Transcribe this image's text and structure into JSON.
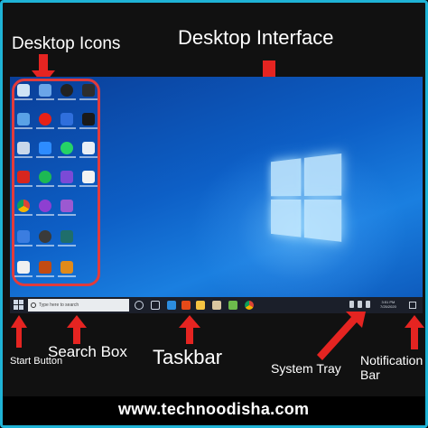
{
  "annotations": {
    "desktop_icons": "Desktop Icons",
    "desktop_interface": "Desktop Interface",
    "start_button": "Start Button",
    "search_box": "Search Box",
    "taskbar": "Taskbar",
    "system_tray": "System Tray",
    "notification_bar": "Notification Bar"
  },
  "taskbar": {
    "search_placeholder": "Type here to search",
    "clock_time": "3:51 PM",
    "clock_date": "7/25/2020"
  },
  "footer": {
    "url": "www.technoodisha.com"
  },
  "colors": {
    "frame_border": "#1fb3d6",
    "highlight_box": "#e23b3b",
    "arrow": "#e52421",
    "desktop_blue": "#0d5fc6",
    "taskbar": "#1b1f2a"
  }
}
